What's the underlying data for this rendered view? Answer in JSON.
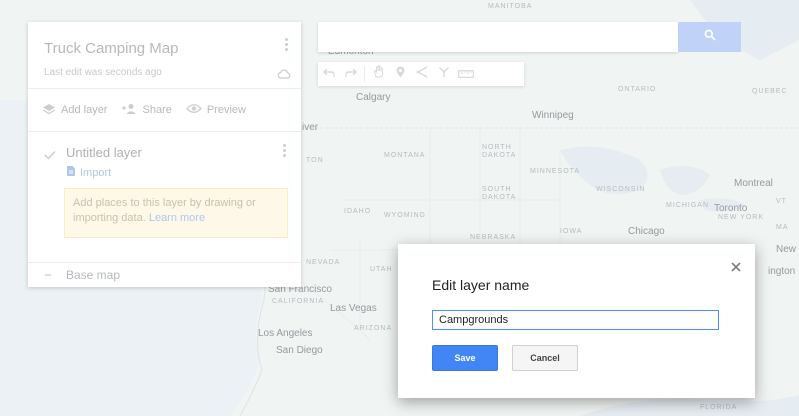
{
  "map_panel": {
    "title": "Truck Camping Map",
    "last_edit": "Last edit was seconds ago",
    "actions": {
      "add_layer": "Add layer",
      "share": "Share",
      "preview": "Preview"
    },
    "layer": {
      "name": "Untitled layer",
      "import_label": "Import",
      "hint_text": "Add places to this layer by drawing or importing data.",
      "learn_more": "Learn more"
    },
    "base_map_label": "Base map"
  },
  "search": {
    "value": "",
    "placeholder": ""
  },
  "toolbar": {
    "icons": [
      "undo-icon",
      "redo-icon",
      "hand-icon",
      "marker-icon",
      "line-icon",
      "directions-icon",
      "ruler-icon"
    ]
  },
  "map_labels": {
    "manitoba": "MANITOBA",
    "edmonton": "Edmonton",
    "calgary": "Calgary",
    "ontario": "ONTARIO",
    "quebec": "QUEBEC",
    "winnipeg": "Winnipeg",
    "montana": "MONTANA",
    "north_dakota_1": "NORTH",
    "north_dakota_2": "DAKOTA",
    "minnesota": "MINNESOTA",
    "south_dakota_1": "SOUTH",
    "south_dakota_2": "DAKOTA",
    "wisconsin": "WISCONSIN",
    "michigan": "MICHIGAN",
    "montreal": "Montreal",
    "toronto": "Toronto",
    "new_york": "NEW YORK",
    "idaho": "IDAHO",
    "wyoming": "WYOMING",
    "nebraska": "NEBRASKA",
    "iowa": "IOWA",
    "chicago": "Chicago",
    "nevada": "NEVADA",
    "utah": "UTAH",
    "san_francisco": "San Francisco",
    "california": "CALIFORNIA",
    "las_vegas": "Las Vegas",
    "arizona": "ARIZONA",
    "los_angeles": "Los Angeles",
    "san_diego": "San Diego",
    "new_partial": "New",
    "washington_partial": "ington",
    "ma_partial": "MA",
    "vt_partial": "VT",
    "florida": "FLORIDA",
    "ton_partial": "TON",
    "iver_partial": "iver"
  },
  "dialog": {
    "title": "Edit layer name",
    "input_value": "Campgrounds",
    "save_label": "Save",
    "cancel_label": "Cancel"
  },
  "colors": {
    "accent": "#4285f4",
    "search_button": "#a8c1f5",
    "hint_background": "#fdf6e0",
    "link": "#8fb2e6"
  }
}
